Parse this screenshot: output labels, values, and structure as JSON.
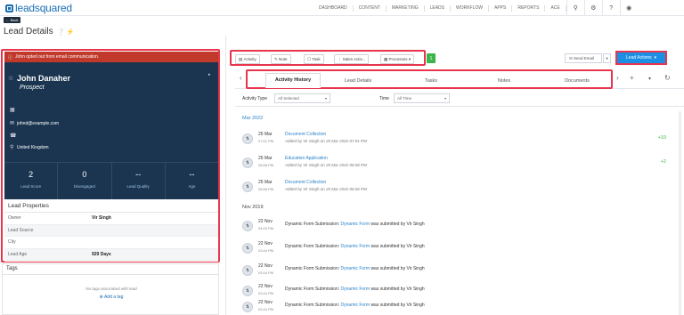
{
  "topbar": {
    "logo_text": "leadsquared",
    "nav": [
      "DASHBOARD",
      "CONTENT",
      "MARKETING",
      "LEADS",
      "WORKFLOW",
      "APPS",
      "REPORTS",
      "ACE"
    ],
    "icons": [
      "search-icon",
      "settings-icon",
      "help-icon",
      "user-icon"
    ]
  },
  "back_label": "Back",
  "page_title": "Lead Details",
  "lead": {
    "optout_msg": "John opted out from email communication.",
    "name": "John Danaher",
    "status": "Prospect",
    "email": "johnd@example.com",
    "country": "United Kingdom",
    "stats": [
      {
        "value": "2",
        "label": "Lead Score"
      },
      {
        "value": "0",
        "label": "Disengaged"
      },
      {
        "value": "--",
        "label": "Lead Quality"
      },
      {
        "value": "--",
        "label": "Age"
      }
    ]
  },
  "properties": {
    "title": "Lead Properties",
    "rows": [
      {
        "key": "Owner",
        "value": "Vir Singh"
      },
      {
        "key": "Lead Source",
        "value": ""
      },
      {
        "key": "City",
        "value": ""
      },
      {
        "key": "Lead Age",
        "value": "929 Days"
      }
    ]
  },
  "tags": {
    "title": "Tags",
    "empty": "No tags associated with lead",
    "add": "Add a tag"
  },
  "actions": {
    "activity": "Activity",
    "note": "Note",
    "task": "Task",
    "sales": "Sales Activ...",
    "processes": "Processes",
    "badge": "1",
    "send_email": "Send Email",
    "lead_actions": "Lead Actions"
  },
  "tabs": [
    "Activity History",
    "Lead Details",
    "Tasks",
    "Notes",
    "Documents"
  ],
  "filters": {
    "type_label": "Activity Type",
    "type_value": "All Selected",
    "time_label": "Time",
    "time_value": "All Time"
  },
  "timeline": {
    "month1": "Mar 2022",
    "month2": "Nov 2019",
    "items_mar": [
      {
        "date": "25 Mar",
        "time": "07:01 PM",
        "title": "Document Collection",
        "sub": "Added by Vir Singh on 25 Mar 2022 07:01 PM",
        "score": "+10"
      },
      {
        "date": "25 Mar",
        "time": "06:58 PM",
        "title": "Education Application",
        "sub": "Added by Vir Singh on 25 Mar 2022 06:58 PM",
        "score": "+2"
      },
      {
        "date": "25 Mar",
        "time": "06:56 PM",
        "title": "Document Collection",
        "sub": "Added by Vir Singh on 25 Mar 2022 06:56 PM",
        "score": ""
      }
    ],
    "items_nov": [
      {
        "date": "22 Nov",
        "time": "04:03 PM",
        "pre": "Dynamic Form Submission:",
        "link": "Dynamic Form",
        "post": "was submitted by Vir Singh"
      },
      {
        "date": "22 Nov",
        "time": "03:44 PM",
        "pre": "Dynamic Form Submission:",
        "link": "Dynamic Form",
        "post": "was submitted by Vir Singh"
      },
      {
        "date": "22 Nov",
        "time": "03:44 PM",
        "pre": "Dynamic Form Submission:",
        "link": "Dynamic Form",
        "post": "was submitted by Vir Singh"
      },
      {
        "date": "22 Nov",
        "time": "03:44 PM",
        "pre": "Dynamic Form Submission:",
        "link": "Dynamic Form",
        "post": "was submitted by Vir Singh"
      },
      {
        "date": "22 Nov",
        "time": "03:44 PM",
        "pre": "Dynamic Form Submission:",
        "link": "Dynamic Form",
        "post": "was submitted by Vir Singh"
      }
    ]
  }
}
